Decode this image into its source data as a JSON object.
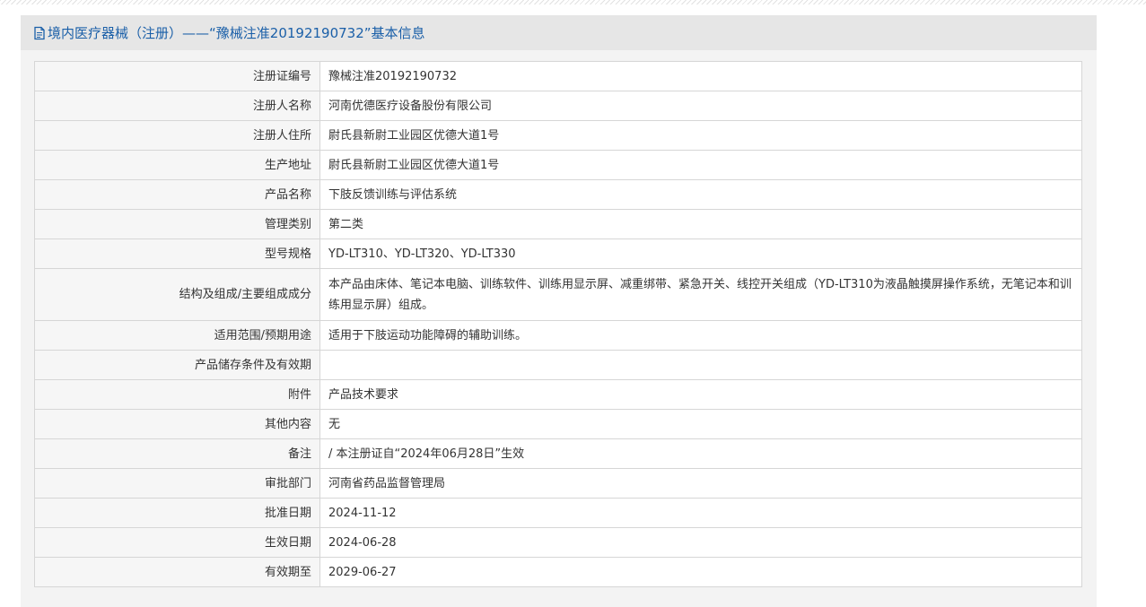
{
  "panel": {
    "title": "境内医疗器械（注册）——“豫械注准20192190732”基本信息",
    "icon": "document-icon"
  },
  "rows": [
    {
      "label": "注册证编号",
      "value": "豫械注准20192190732"
    },
    {
      "label": "注册人名称",
      "value": "河南优德医疗设备股份有限公司"
    },
    {
      "label": "注册人住所",
      "value": "尉氏县新尉工业园区优德大道1号"
    },
    {
      "label": "生产地址",
      "value": "尉氏县新尉工业园区优德大道1号"
    },
    {
      "label": "产品名称",
      "value": "下肢反馈训练与评估系统"
    },
    {
      "label": "管理类别",
      "value": "第二类"
    },
    {
      "label": "型号规格",
      "value": "YD-LT310、YD-LT320、YD-LT330"
    },
    {
      "label": "结构及组成/主要组成成分",
      "value": "本产品由床体、笔记本电脑、训练软件、训练用显示屏、减重绑带、紧急开关、线控开关组成（YD-LT310为液晶触摸屏操作系统，无笔记本和训练用显示屏）组成。"
    },
    {
      "label": "适用范围/预期用途",
      "value": "适用于下肢运动功能障碍的辅助训练。"
    },
    {
      "label": "产品储存条件及有效期",
      "value": ""
    },
    {
      "label": "附件",
      "value": "产品技术要求"
    },
    {
      "label": "其他内容",
      "value": "无"
    },
    {
      "label": "备注",
      "value": "/ 本注册证自“2024年06月28日”生效"
    },
    {
      "label": "审批部门",
      "value": "河南省药品监督管理局"
    },
    {
      "label": "批准日期",
      "value": "2024-11-12"
    },
    {
      "label": "生效日期",
      "value": "2024-06-28"
    },
    {
      "label": "有效期至",
      "value": "2029-06-27"
    }
  ]
}
